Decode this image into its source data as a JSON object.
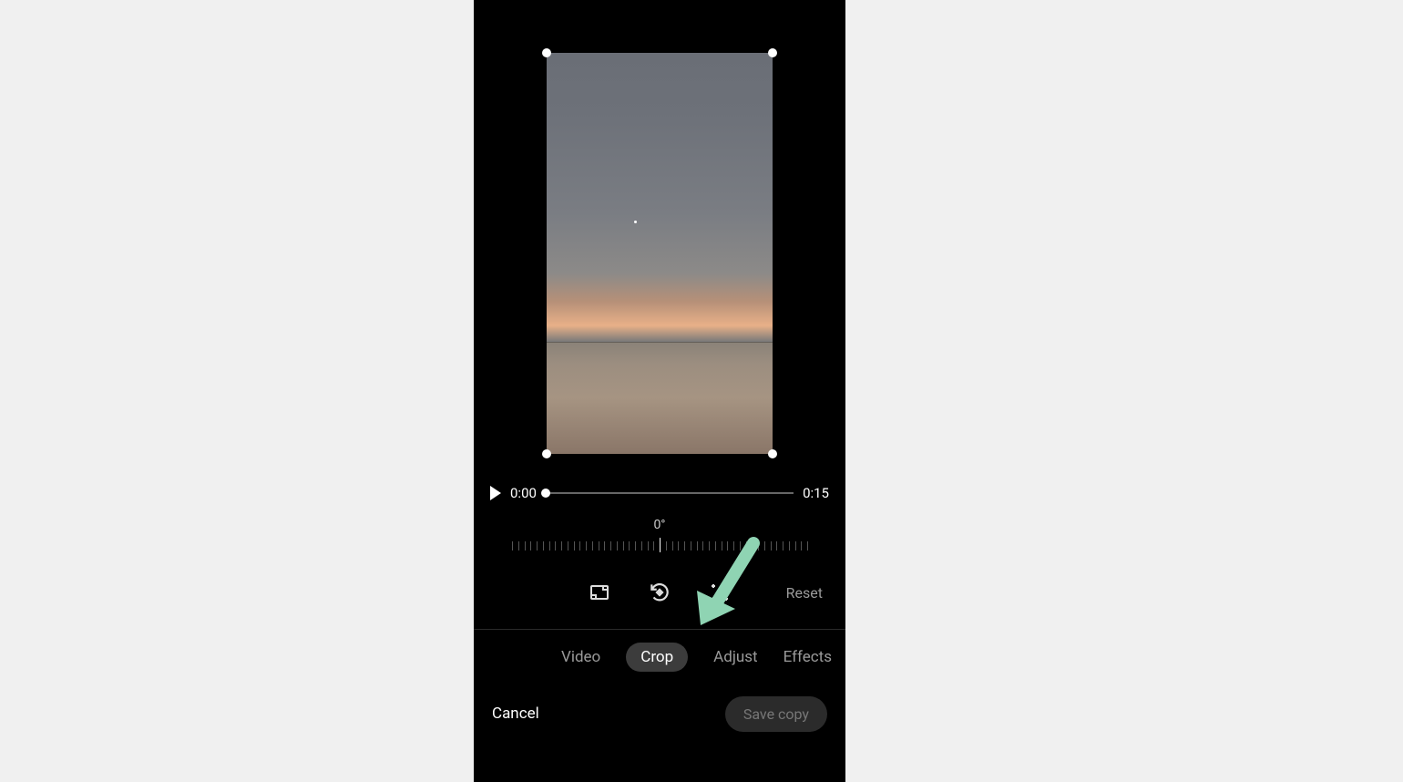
{
  "playback": {
    "current_time": "0:00",
    "duration": "0:15"
  },
  "angle": {
    "value": "0°"
  },
  "tools": {
    "aspect_icon": "aspect-ratio",
    "rotate_icon": "rotate-ccw",
    "transform_icon": "transform",
    "reset_label": "Reset"
  },
  "tabs": {
    "items": [
      "Video",
      "Crop",
      "Adjust",
      "Effects"
    ],
    "active": "Crop"
  },
  "actions": {
    "cancel": "Cancel",
    "save": "Save copy"
  },
  "annotation": {
    "arrow_color": "#8fd4b3"
  }
}
